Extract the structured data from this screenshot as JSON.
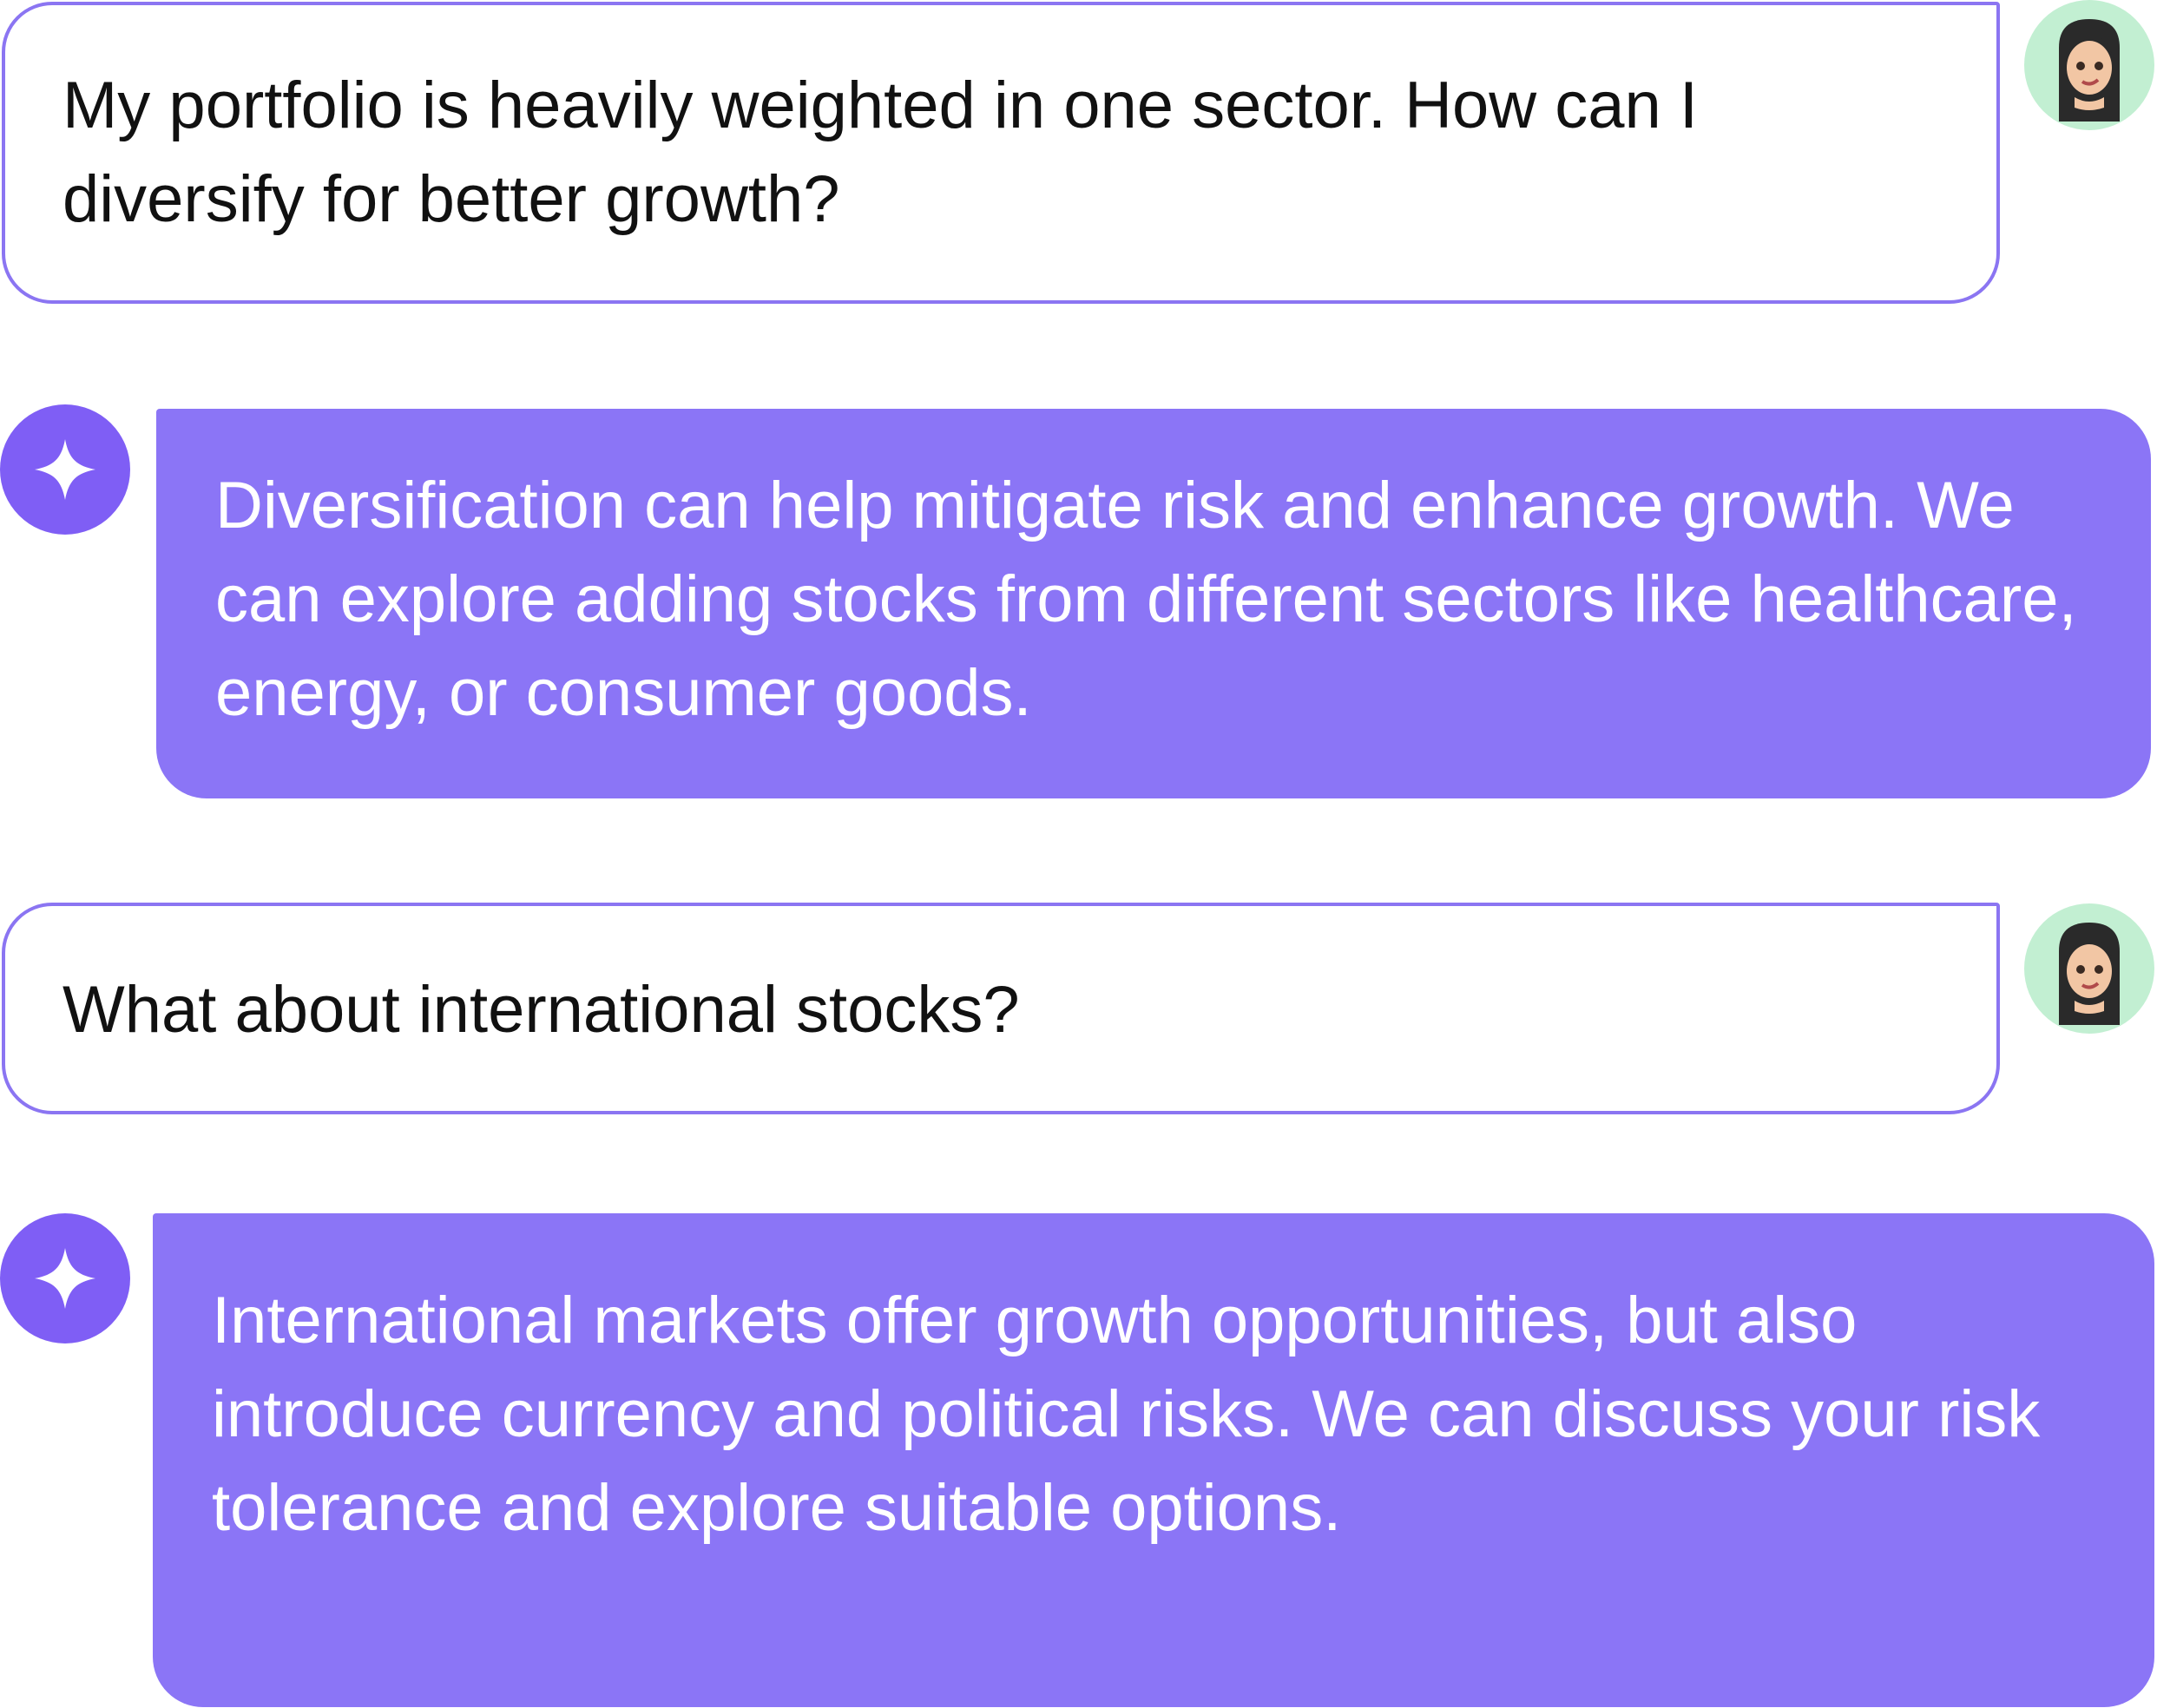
{
  "conversation": {
    "messages": [
      {
        "role": "user",
        "text": "My portfolio is heavily weighted in one sector. How can I diversify for better growth?",
        "avatar_icon": "user-avatar-icon"
      },
      {
        "role": "assistant",
        "text": "Diversification can help mitigate risk and enhance growth. We can explore adding stocks from different sectors like healthcare, energy, or consumer goods.",
        "avatar_icon": "sparkle-icon"
      },
      {
        "role": "user",
        "text": "What about international stocks?",
        "avatar_icon": "user-avatar-icon"
      },
      {
        "role": "assistant",
        "text": "International markets offer growth opportunities, but also introduce currency and political risks. We can discuss your risk tolerance and explore suitable options.",
        "avatar_icon": "sparkle-icon"
      }
    ]
  },
  "colors": {
    "assistant_bubble": "#8b75f6",
    "assistant_icon_bg": "#7f5ef5",
    "user_bubble_border": "#8b75f2",
    "user_avatar_bg": "#c2efd2",
    "user_text": "#111111",
    "assistant_text": "#ffffff"
  }
}
